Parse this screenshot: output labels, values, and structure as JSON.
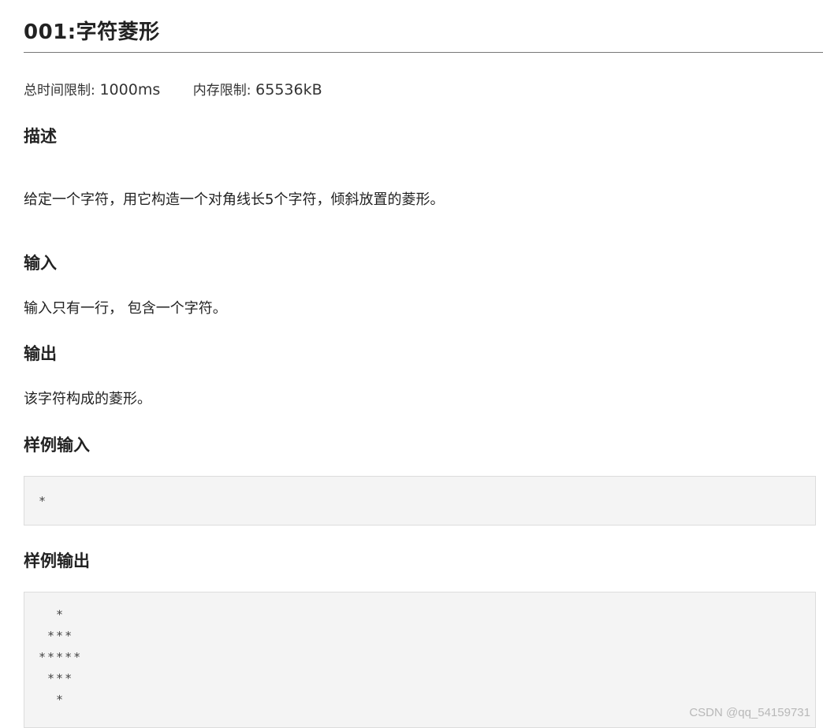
{
  "problem": {
    "title": "001:字符菱形",
    "time_limit_label": "总时间限制:",
    "time_limit_value": "1000ms",
    "memory_limit_label": "内存限制:",
    "memory_limit_value": "65536kB"
  },
  "sections": {
    "description_heading": "描述",
    "description_text": "给定一个字符，用它构造一个对角线长5个字符，倾斜放置的菱形。",
    "input_heading": "输入",
    "input_text": "输入只有一行， 包含一个字符。",
    "output_heading": "输出",
    "output_text": "该字符构成的菱形。",
    "sample_input_heading": "样例输入",
    "sample_input": "*",
    "sample_output_heading": "样例输出",
    "sample_output": "  *\n ***\n*****\n ***\n  *"
  },
  "watermark": "CSDN @qq_54159731"
}
